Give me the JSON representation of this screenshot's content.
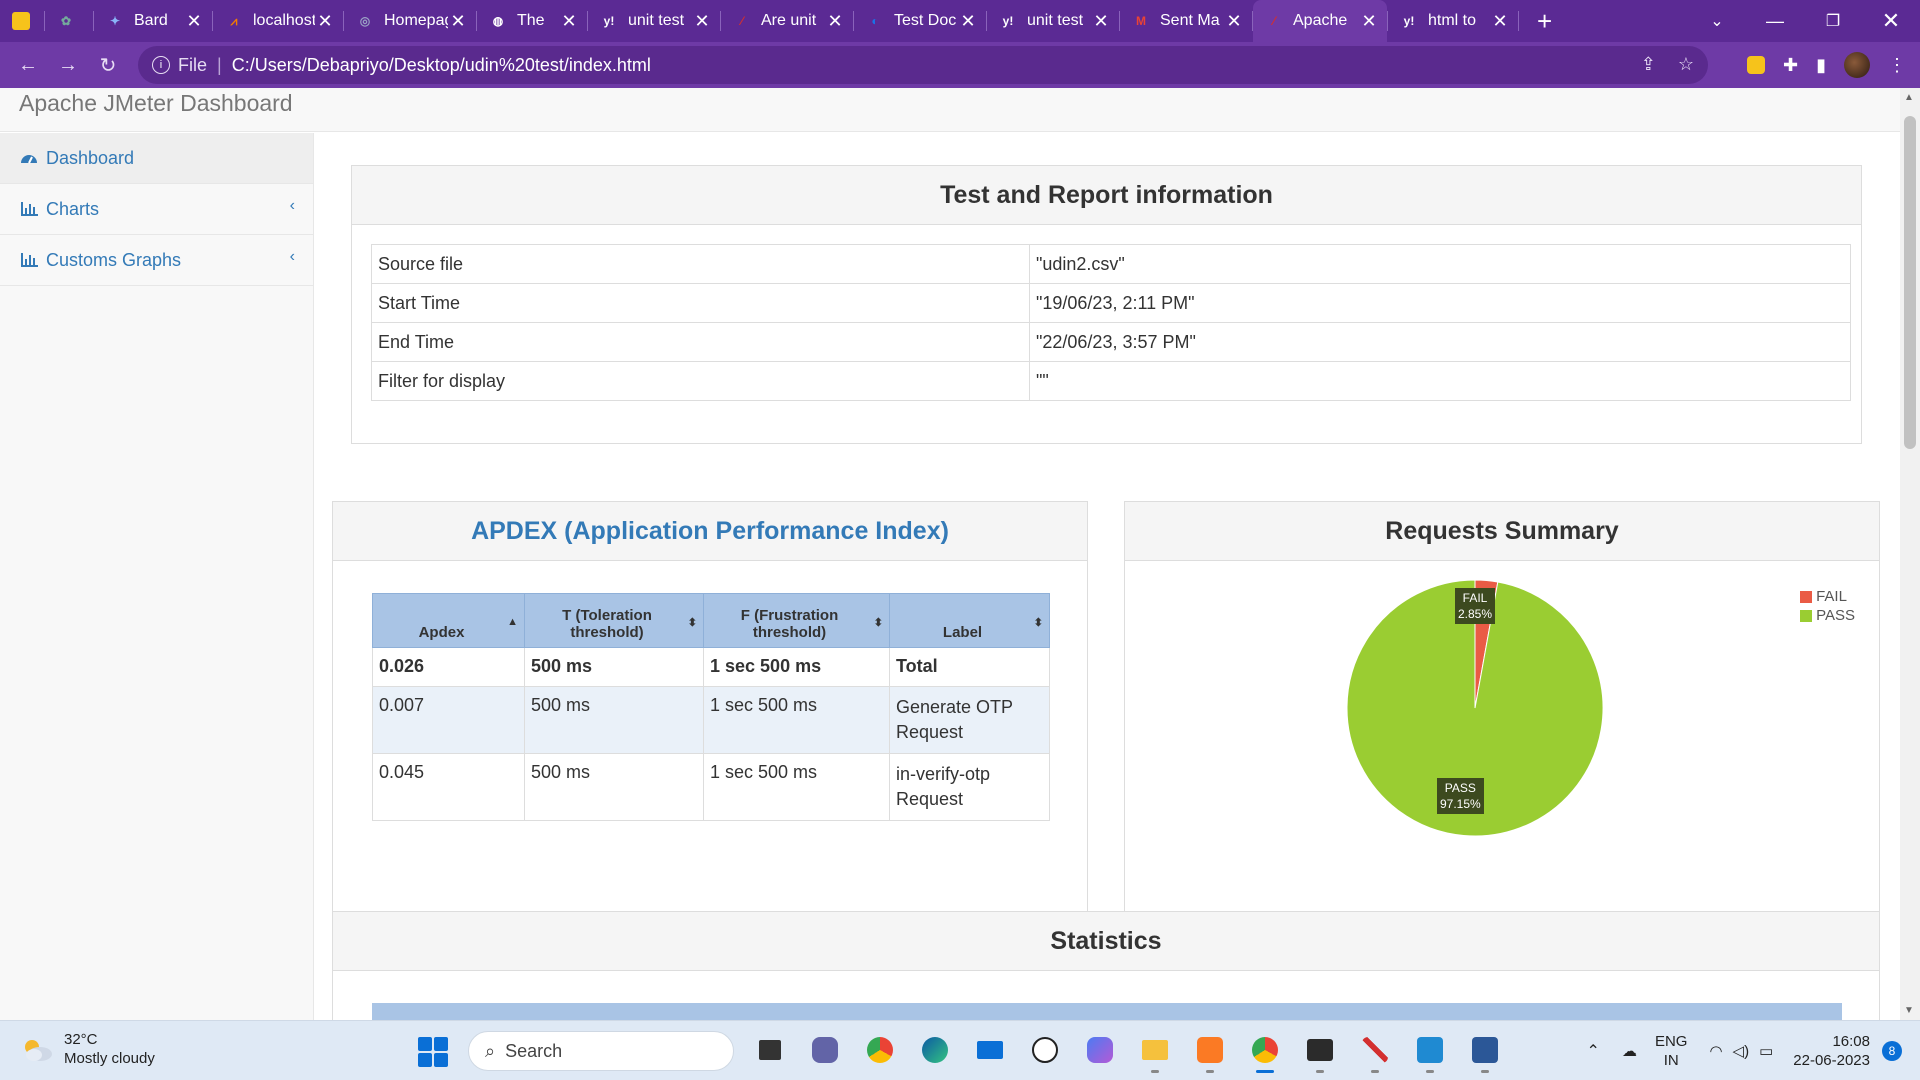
{
  "browser": {
    "tabs": [
      {
        "title": "",
        "icon": "keep-icon",
        "color": "#f6c31b"
      },
      {
        "title": "",
        "icon": "openai-icon",
        "color": "#74aa9c"
      },
      {
        "title": "Bard",
        "icon": "bard-icon",
        "color": "#8ab4f8"
      },
      {
        "title": "localhost",
        "icon": "xampp-icon",
        "color": "#f57c00"
      },
      {
        "title": "Homepage",
        "icon": "homepage-icon",
        "color": "#9aa0c4"
      },
      {
        "title": "The",
        "icon": "globe-icon",
        "color": "#ffffff"
      },
      {
        "title": "unit test",
        "icon": "yahoo-icon",
        "color": "#ffffff"
      },
      {
        "title": "Are unit",
        "icon": "jmeter-feather-icon",
        "color": "#d32f2f"
      },
      {
        "title": "Test Doc",
        "icon": "testdoc-icon",
        "color": "#1a73e8"
      },
      {
        "title": "unit test",
        "icon": "yahoo-icon",
        "color": "#ffffff"
      },
      {
        "title": "Sent Ma",
        "icon": "gmail-icon",
        "color": "#ea4335"
      },
      {
        "title": "Apache",
        "icon": "apache-feather-icon",
        "color": "#d32f2f",
        "active": true
      },
      {
        "title": "html to",
        "icon": "yahoo-icon",
        "color": "#ffffff"
      }
    ],
    "address": {
      "scheme": "File",
      "url": "C:/Users/Debapriyo/Desktop/udin%20test/index.html"
    }
  },
  "app": {
    "title": "Apache JMeter Dashboard",
    "sidebar": [
      {
        "label": "Dashboard",
        "icon": "dashboard-icon"
      },
      {
        "label": "Charts",
        "icon": "bar-chart-icon"
      },
      {
        "label": "Customs Graphs",
        "icon": "bar-chart-icon"
      }
    ]
  },
  "test_info": {
    "title": "Test and Report information",
    "rows": [
      {
        "label": "Source file",
        "value": "\"udin2.csv\""
      },
      {
        "label": "Start Time",
        "value": "\"19/06/23, 2:11 PM\""
      },
      {
        "label": "End Time",
        "value": "\"22/06/23, 3:57 PM\""
      },
      {
        "label": "Filter for display",
        "value": "\"\""
      }
    ]
  },
  "apdex": {
    "title": "APDEX (Application Performance Index)",
    "headers": [
      "Apdex",
      "T (Toleration threshold)",
      "F (Frustration threshold)",
      "Label"
    ],
    "rows": [
      {
        "apdex": "0.026",
        "t": "500 ms",
        "f": "1 sec 500 ms",
        "label": "Total"
      },
      {
        "apdex": "0.007",
        "t": "500 ms",
        "f": "1 sec 500 ms",
        "label": "Generate OTP Request"
      },
      {
        "apdex": "0.045",
        "t": "500 ms",
        "f": "1 sec 500 ms",
        "label": "in-verify-otp Request"
      }
    ]
  },
  "requests_summary": {
    "title": "Requests Summary",
    "fail_label": "FAIL",
    "pass_label": "PASS",
    "fail_pct": "2.85%",
    "pass_pct": "97.15%",
    "fail_color": "#ea5b45",
    "pass_color": "#9acd32"
  },
  "chart_data": {
    "type": "pie",
    "title": "Requests Summary",
    "categories": [
      "FAIL",
      "PASS"
    ],
    "values": [
      2.85,
      97.15
    ],
    "legend": "top-right"
  },
  "statistics": {
    "title": "Statistics"
  },
  "taskbar": {
    "weather_temp": "32°C",
    "weather_desc": "Mostly cloudy",
    "search": "Search",
    "lang1": "ENG",
    "lang2": "IN",
    "time": "16:08",
    "date": "22-06-2023",
    "notif_count": "8"
  }
}
